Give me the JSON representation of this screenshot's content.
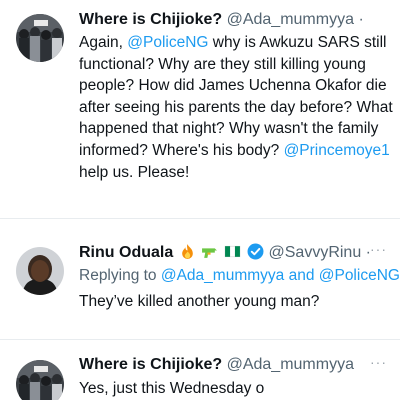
{
  "tweets": [
    {
      "display_name": "Where is Chijioke?",
      "handle": "@Ada_mummyya",
      "dot": "·",
      "text_parts": [
        {
          "t": "Again, ",
          "m": false
        },
        {
          "t": "@PoliceNG",
          "m": true
        },
        {
          "t": " why is Awkuzu SARS still functional? Why are they still killing young people? How did James Uchenna Okafor die after seeing his parents the day before? What happened that night? Why wasn't the family informed? Where's his body? ",
          "m": false
        },
        {
          "t": "@Princemoye1",
          "m": true
        },
        {
          "t": " help us. Please!",
          "m": false
        }
      ],
      "avatar": "crowd-photo"
    },
    {
      "display_name": "Rinu Oduala",
      "handle": "@SavvyRinu",
      "dot": "·",
      "more_label": "···",
      "replying_prefix": "Replying to ",
      "replying_to": "@Ada_mummyya and @PoliceNG",
      "text": "They’ve killed another young man?",
      "emojis": [
        "fire",
        "water-pistol",
        "flag"
      ],
      "verified": true,
      "avatar": "portrait"
    },
    {
      "display_name": "Where is Chijioke?",
      "handle": "@Ada_mummyya",
      "more_label": "···",
      "text": "Yes, just this Wednesday o",
      "avatar": "crowd-photo"
    }
  ],
  "colors": {
    "accent": "#1d9bf0",
    "secondary_text": "#536471",
    "primary_text": "#0f1419",
    "divider": "#e8ecef"
  }
}
